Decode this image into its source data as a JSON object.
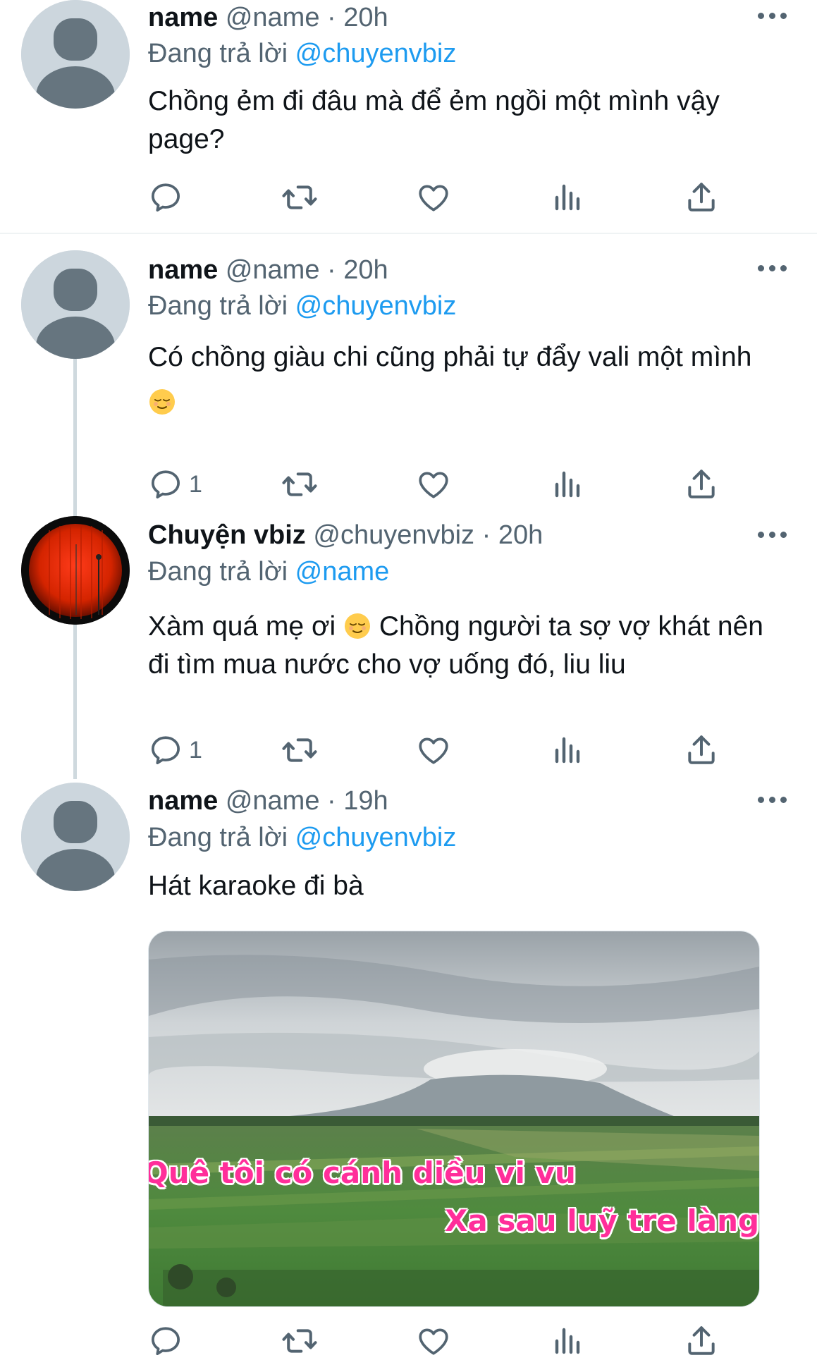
{
  "tweets": [
    {
      "name": "name",
      "handle": "@name",
      "time": "20h",
      "reply_label": "Đang trả lời",
      "reply_to": "@chuyenvbiz",
      "text": "Chồng ẻm đi đâu mà để ẻm ngồi một mình vậy page?",
      "reply_count": ""
    },
    {
      "name": "name",
      "handle": "@name",
      "time": "20h",
      "reply_label": "Đang trả lời",
      "reply_to": "@chuyenvbiz",
      "text": "Có chồng giàu chi cũng phải tự đẩy vali một mình",
      "reply_count": "1"
    },
    {
      "name": "Chuyện vbiz",
      "handle": "@chuyenvbiz",
      "time": "20h",
      "reply_label": "Đang trả lời",
      "reply_to": "@name",
      "text_a": "Xàm quá mẹ ơi",
      "text_b": "Chồng người ta sợ vợ khát nên đi tìm mua nước cho vợ uống đó, liu liu",
      "reply_count": "1"
    },
    {
      "name": "name",
      "handle": "@name",
      "time": "19h",
      "reply_label": "Đang trả lời",
      "reply_to": "@chuyenvbiz",
      "text": "Hát karaoke đi bà",
      "media_caption_1": "Quê tôi có cánh diều vi vu",
      "media_caption_2": "Xa sau luỹ tre làng"
    }
  ],
  "separator": "·",
  "icons": {
    "reply": "reply-icon",
    "retweet": "retweet-icon",
    "like": "like-icon",
    "views": "views-icon",
    "share": "share-icon",
    "more": "more-icon",
    "emoji": "relieved-face-emoji"
  },
  "colors": {
    "link": "#1d9bf0",
    "secondary_text": "#536471",
    "karaoke_text": "#ff2e9a"
  }
}
